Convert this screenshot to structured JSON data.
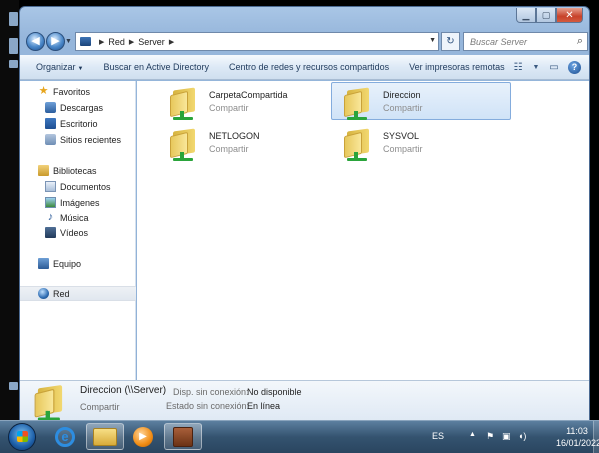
{
  "address_bar": {
    "segments": [
      "Red",
      "Server"
    ],
    "search_placeholder": "Buscar Server"
  },
  "toolbar": {
    "organize": "Organizar",
    "search_ad": "Buscar en Active Directory",
    "network_center": "Centro de redes y recursos compartidos",
    "remote_printers": "Ver impresoras remotas"
  },
  "sidebar": {
    "favorites_header": "Favoritos",
    "favorites": [
      "Descargas",
      "Escritorio",
      "Sitios recientes"
    ],
    "libraries_header": "Bibliotecas",
    "libraries": [
      "Documentos",
      "Imágenes",
      "Música",
      "Vídeos"
    ],
    "computer": "Equipo",
    "network": "Red"
  },
  "shares": [
    {
      "name": "CarpetaCompartida",
      "type": "Compartir"
    },
    {
      "name": "Direccion",
      "type": "Compartir"
    },
    {
      "name": "NETLOGON",
      "type": "Compartir"
    },
    {
      "name": "SYSVOL",
      "type": "Compartir"
    }
  ],
  "details": {
    "title": "Direccion (\\\\Server)",
    "subtitle": "Compartir",
    "offline_avail_label": "Disp. sin conexión:",
    "offline_avail_value": "No disponible",
    "offline_status_label": "Estado sin conexión:",
    "offline_status_value": "En línea"
  },
  "taskbar": {
    "language": "ES",
    "time": "11:03",
    "date": "16/01/2022"
  },
  "colors": {
    "selection_fill": "#d0e3f7",
    "selection_border": "#84acdd",
    "toolbar_text": "#1e395b"
  }
}
